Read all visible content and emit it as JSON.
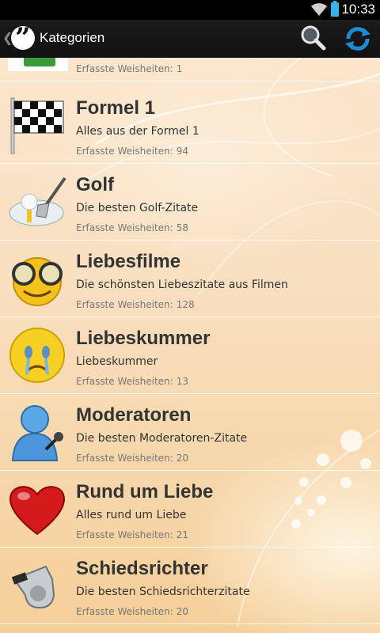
{
  "status_bar": {
    "time": "10:33",
    "icons": [
      "wifi-icon",
      "battery-icon"
    ],
    "battery_color": "#33b5e5"
  },
  "action_bar": {
    "up_icon": "chevron-left-icon",
    "app_icon": "quote-icon",
    "title": "Kategorien",
    "actions": [
      {
        "icon": "search-icon"
      },
      {
        "icon": "refresh-icon"
      }
    ]
  },
  "list": {
    "count_label": "Erfasste Weisheiten:",
    "partial_top": {
      "count": "1",
      "icon": "unknown-icon"
    },
    "items": [
      {
        "name": "Formel 1",
        "desc": "Alles aus der Formel 1",
        "count": "94",
        "icon": "checkered-flag-icon"
      },
      {
        "name": "Golf",
        "desc": "Die besten Golf-Zitate",
        "count": "58",
        "icon": "golf-club-icon"
      },
      {
        "name": "Liebesfilme",
        "desc": "Die schönsten Liebeszitate aus Filmen",
        "count": "128",
        "icon": "smiley-glasses-icon"
      },
      {
        "name": "Liebeskummer",
        "desc": "Liebeskummer",
        "count": "13",
        "icon": "crying-face-icon"
      },
      {
        "name": "Moderatoren",
        "desc": "Die besten Moderatoren-Zitate",
        "count": "20",
        "icon": "person-microphone-icon"
      },
      {
        "name": "Rund um Liebe",
        "desc": "Alles rund um Liebe",
        "count": "21",
        "icon": "heart-icon"
      },
      {
        "name": "Schiedsrichter",
        "desc": "Die besten Schiedsrichterzitate",
        "count": "20",
        "icon": "whistle-icon"
      }
    ]
  },
  "colors": {
    "action_bar": "#111111",
    "refresh_icon": "#1f8bd6",
    "heart": "#d41a1a"
  }
}
